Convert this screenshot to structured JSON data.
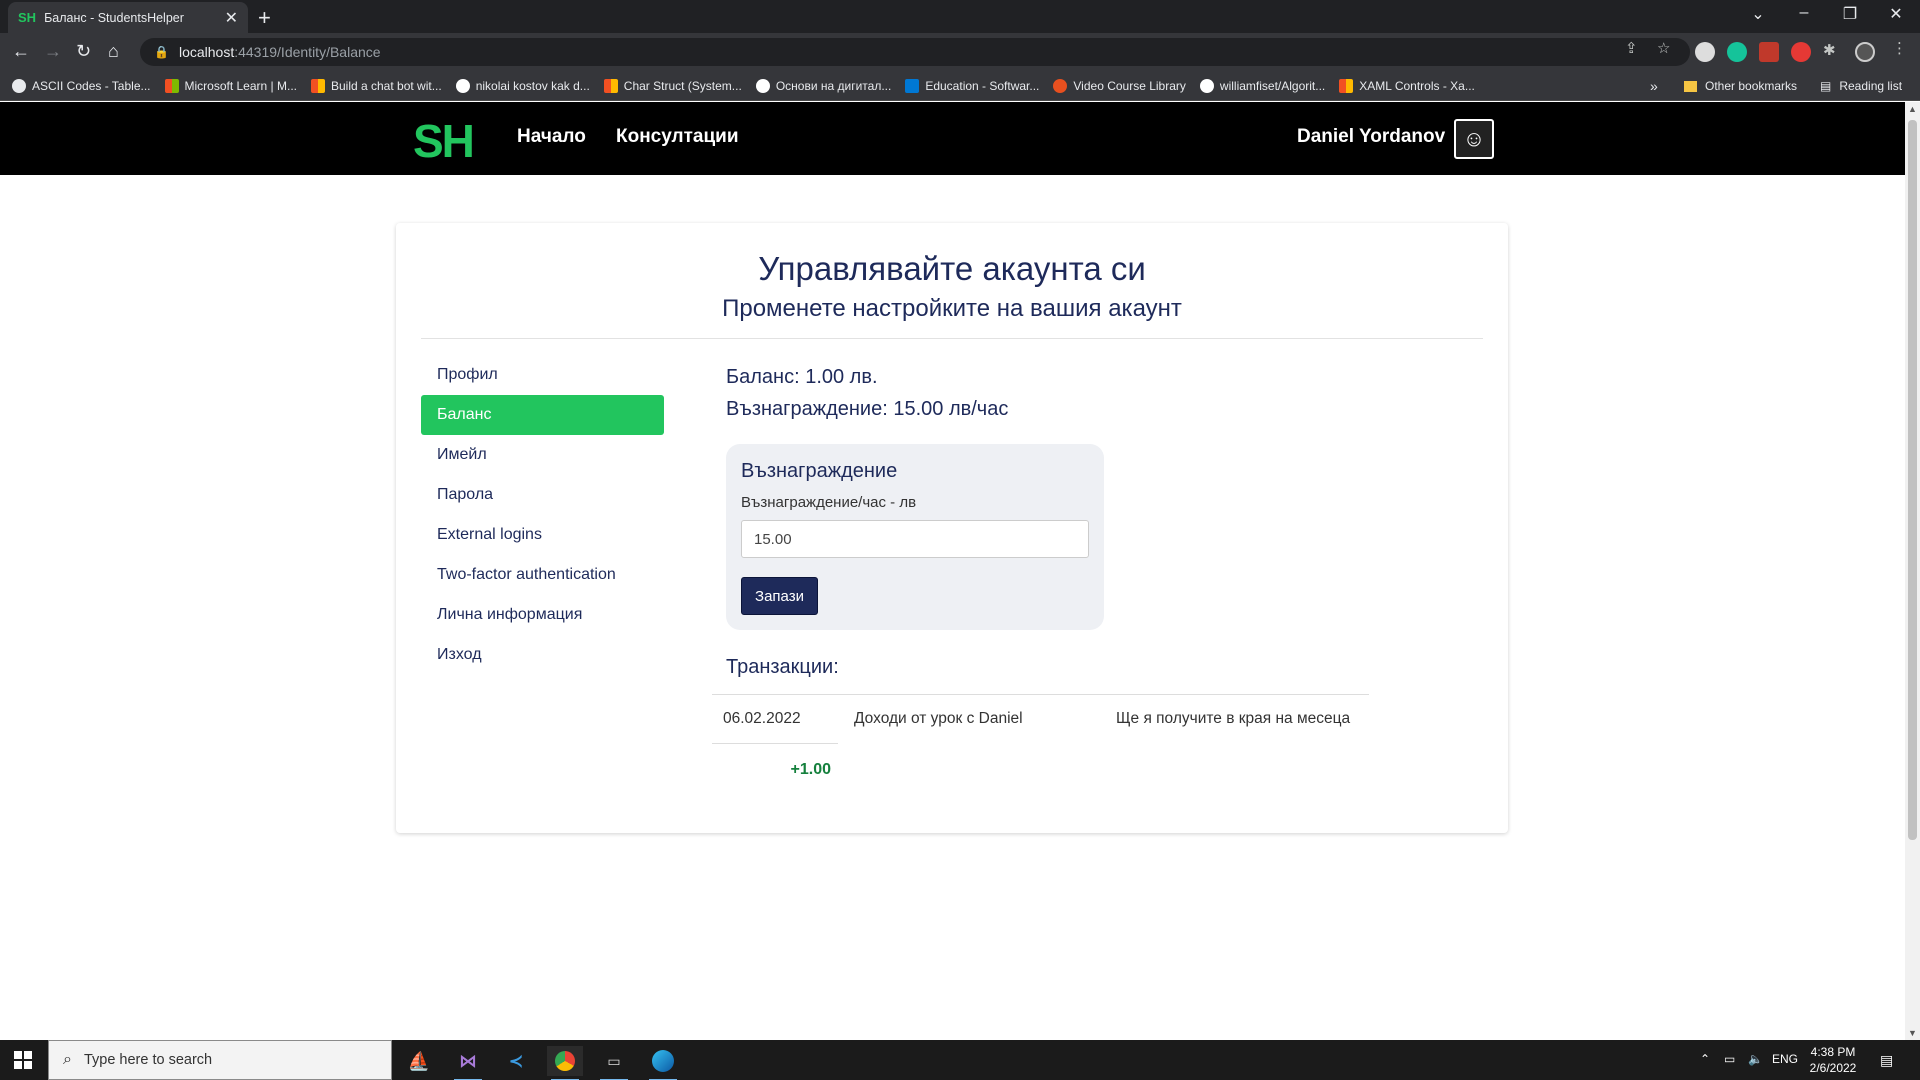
{
  "browser": {
    "tab_title": "Баланс - StudentsHelper",
    "tab_favicon": "SH",
    "url_host": "localhost",
    "url_path": ":44319/Identity/Balance",
    "bookmarks": [
      {
        "label": "ASCII Codes - Table...",
        "icon_color": "#e8eaed"
      },
      {
        "label": "Microsoft Learn | M...",
        "icon_color": "#f25022"
      },
      {
        "label": "Build a chat bot wit...",
        "icon_color": "#f25022"
      },
      {
        "label": "nikolai kostov kak d...",
        "icon_color": "#ffffff"
      },
      {
        "label": "Char Struct (System...",
        "icon_color": "#f25022"
      },
      {
        "label": "Основи на дигитал...",
        "icon_color": "#ffffff"
      },
      {
        "label": "Education - Softwar...",
        "icon_color": "#0078d4"
      },
      {
        "label": "Video Course Library",
        "icon_color": "#e8501f"
      },
      {
        "label": "williamfiset/Algorit...",
        "icon_color": "#ffffff"
      },
      {
        "label": "XAML Controls - Xa...",
        "icon_color": "#f25022"
      }
    ],
    "more_bookmarks": "»",
    "other_bookmarks": "Other bookmarks",
    "reading_list": "Reading list"
  },
  "site": {
    "logo": "SH",
    "nav": {
      "home": "Начало",
      "consultations": "Консултации"
    },
    "user_name": "Daniel Yordanov",
    "accent_color": "#22c55e",
    "primary_color": "#1e2a5a"
  },
  "page": {
    "title": "Управлявайте акаунта си",
    "subtitle": "Променете настройките на вашия акаунт",
    "sidebar": [
      {
        "label": "Профил",
        "active": false
      },
      {
        "label": "Баланс",
        "active": true
      },
      {
        "label": "Имейл",
        "active": false
      },
      {
        "label": "Парола",
        "active": false
      },
      {
        "label": "External logins",
        "active": false
      },
      {
        "label": "Two-factor authentication",
        "active": false
      },
      {
        "label": "Лична информация",
        "active": false
      },
      {
        "label": "Изход",
        "active": false
      }
    ],
    "balance": "Баланс: 1.00 лв.",
    "reward_summary": "Възнаграждение: 15.00 лв/час",
    "reward_form": {
      "title": "Възнаграждение",
      "label": "Възнаграждение/час - лв",
      "value": "15.00",
      "save_label": "Запази"
    },
    "transactions_title": "Транзакции:",
    "transactions": [
      {
        "date": "06.02.2022",
        "description": "Доходи от урок с Daniel",
        "status": "Ще я получите в края на месеца",
        "amount": "+1.00"
      }
    ]
  },
  "taskbar": {
    "search_placeholder": "Type here to search",
    "language": "ENG",
    "time": "4:38 PM",
    "date": "2/6/2022"
  }
}
